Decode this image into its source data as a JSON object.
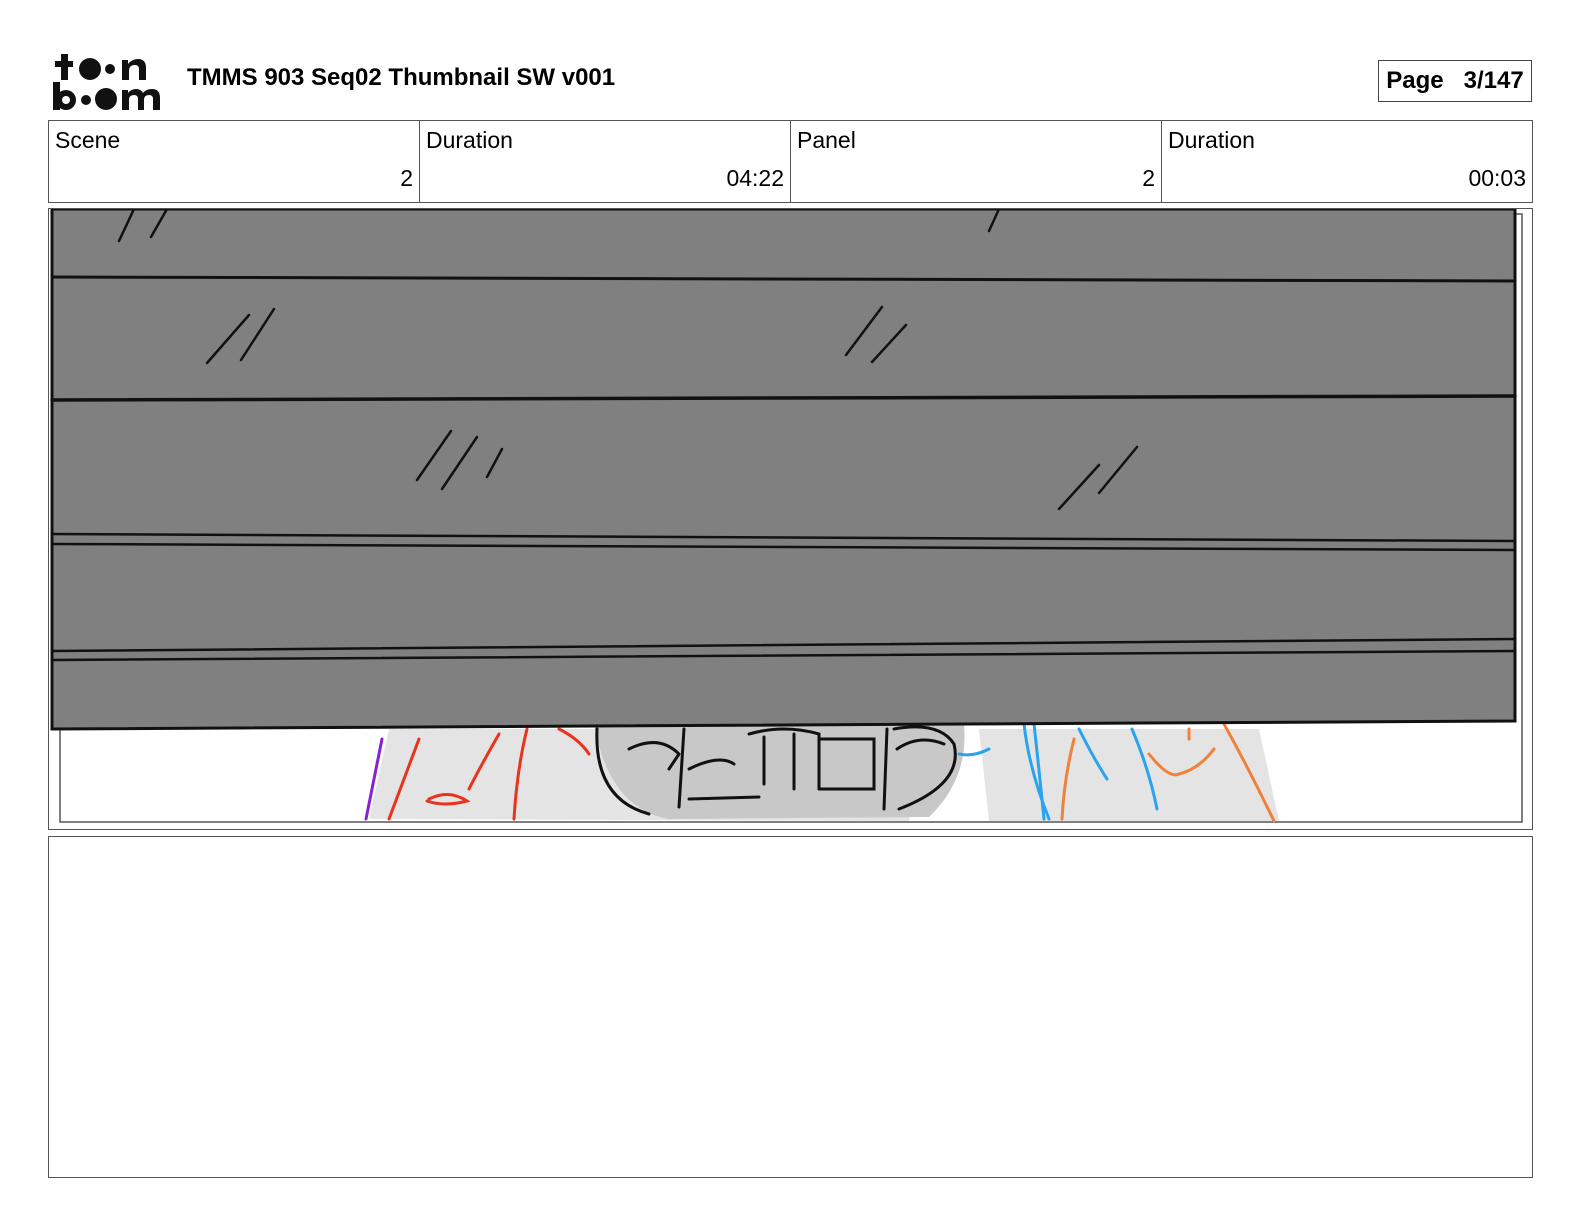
{
  "logo": {
    "alt": "toon boom",
    "icon": "toon-boom-logo"
  },
  "header": {
    "title": "TMMS 903 Seq02 Thumbnail SW v001",
    "page_label": "Page",
    "page_value": "3/147"
  },
  "info": [
    {
      "label": "Scene",
      "value": "2"
    },
    {
      "label": "Duration",
      "value": "04:22"
    },
    {
      "label": "Panel",
      "value": "2"
    },
    {
      "label": "Duration",
      "value": "00:03"
    }
  ],
  "panel": {
    "description_icon": "storyboard-sketch"
  },
  "notes": {
    "text": ""
  },
  "colors": {
    "overlay_gray": "#808080",
    "sketch_red": "#e8341c",
    "sketch_blue": "#2aa3ef",
    "sketch_orange": "#f0803a",
    "sketch_purple": "#8a1fd8"
  }
}
